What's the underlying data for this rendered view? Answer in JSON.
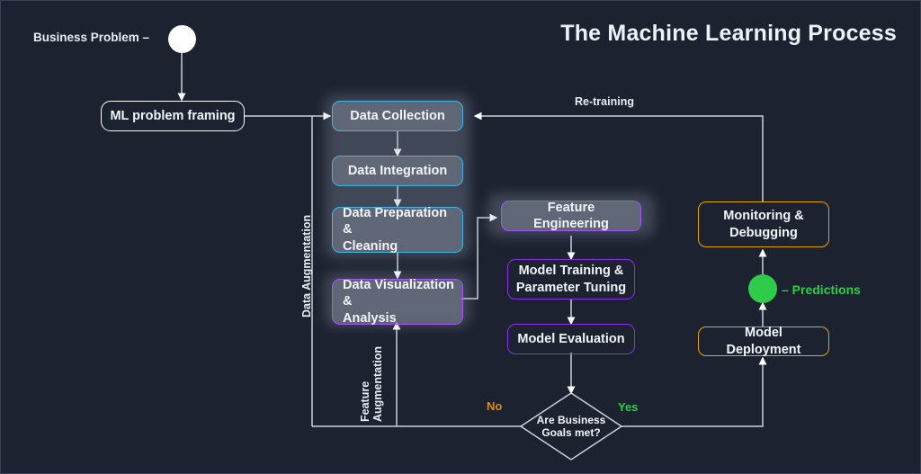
{
  "header": {
    "title": "The Machine Learning Process"
  },
  "start": {
    "label": "Business Problem –",
    "dot_name": "business-problem-dot"
  },
  "nodes": {
    "ml_problem_framing": "ML problem framing",
    "data_collection": "Data Collection",
    "data_integration": "Data Integration",
    "data_preparation": "Data Preparation &\nCleaning",
    "data_visualization": "Data Visualization &\nAnalysis",
    "feature_engineering": "Feature Engineering",
    "model_training": "Model Training &\nParameter Tuning",
    "model_evaluation": "Model Evaluation",
    "model_deployment": "Model Deployment",
    "monitoring": "Monitoring &\nDebugging",
    "decision": "Are Business\nGoals met?"
  },
  "edge_labels": {
    "re_training": "Re-training",
    "data_augmentation": "Data Augmentation",
    "feature_augmentation": "Feature\nAugmentation",
    "no": "No",
    "yes": "Yes",
    "predictions": "– Predictions"
  },
  "colors": {
    "background": "#1c2230",
    "edge": "#d7dbe4",
    "blue_border": "#41b6e6",
    "purple_border": "#a855f7",
    "purple_dark_border": "#8b2fe8",
    "gold_border": "#e3a700",
    "white_border": "#ffffff",
    "green_accent": "#2ecc4a",
    "orange_accent": "#e08a16",
    "title_text": "#eef1f7",
    "panel_glow": "rgba(150,158,175,0.30)"
  }
}
